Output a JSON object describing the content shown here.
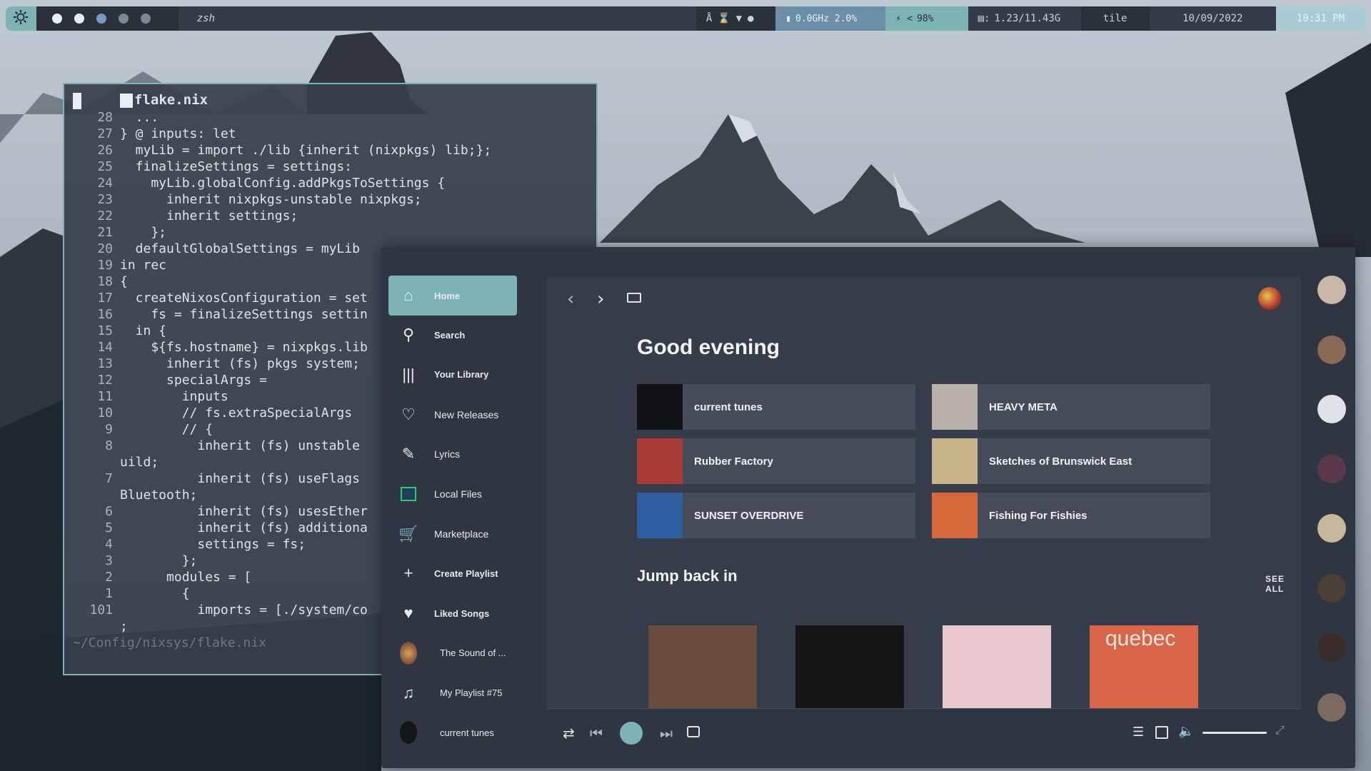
{
  "topbar": {
    "app": "zsh",
    "cpu": "0.0GHz 2.0%",
    "battery": "98%",
    "battery_prefix": "<",
    "memory": "1.23/11.43G",
    "layout": "tile",
    "date": "10/09/2022",
    "time": "10:31 PM",
    "workspace_dots": [
      "#e9eef2",
      "#e9eef2",
      "#7a98c4",
      "#7d8793",
      "#7d8793"
    ]
  },
  "terminal": {
    "title": "flake.nix",
    "path": "~/Config/nixsys/flake.nix",
    "lines": [
      {
        "n": "28",
        "t": "  ..."
      },
      {
        "n": "27",
        "t": "} @ inputs: let"
      },
      {
        "n": "26",
        "t": "  myLib = import ./lib {inherit (nixpkgs) lib;};"
      },
      {
        "n": "25",
        "t": "  finalizeSettings = settings:"
      },
      {
        "n": "24",
        "t": "    myLib.globalConfig.addPkgsToSettings {"
      },
      {
        "n": "23",
        "t": "      inherit nixpkgs-unstable nixpkgs;"
      },
      {
        "n": "22",
        "t": "      inherit settings;"
      },
      {
        "n": "21",
        "t": "    };"
      },
      {
        "n": "20",
        "t": "  defaultGlobalSettings = myLib"
      },
      {
        "n": "19",
        "t": "in rec"
      },
      {
        "n": "18",
        "t": "{"
      },
      {
        "n": "17",
        "t": "  createNixosConfiguration = set"
      },
      {
        "n": "16",
        "t": "    fs = finalizeSettings settin"
      },
      {
        "n": "15",
        "t": "  in {"
      },
      {
        "n": "14",
        "t": "    ${fs.hostname} = nixpkgs.lib"
      },
      {
        "n": "13",
        "t": "      inherit (fs) pkgs system;"
      },
      {
        "n": "12",
        "t": "      specialArgs ="
      },
      {
        "n": "11",
        "t": "        inputs"
      },
      {
        "n": "10",
        "t": "        // fs.extraSpecialArgs"
      },
      {
        "n": "9",
        "t": "        // {"
      },
      {
        "n": "8",
        "t": "          inherit (fs) unstable"
      },
      {
        "n": "",
        "t": "uild;"
      },
      {
        "n": "7",
        "t": "          inherit (fs) useFlags"
      },
      {
        "n": "",
        "t": "Bluetooth;"
      },
      {
        "n": "6",
        "t": "          inherit (fs) usesEther"
      },
      {
        "n": "5",
        "t": "          inherit (fs) additiona"
      },
      {
        "n": "4",
        "t": "          settings = fs;"
      },
      {
        "n": "3",
        "t": "        };"
      },
      {
        "n": "2",
        "t": "      modules = ["
      },
      {
        "n": "1",
        "t": "        {"
      },
      {
        "n": "101",
        "t": "          imports = [./system/co"
      },
      {
        "n": "",
        "t": ";"
      }
    ]
  },
  "sidebar": {
    "items": [
      {
        "label": "Home",
        "icon": "home-icon",
        "bold": true
      },
      {
        "label": "Search",
        "icon": "search-icon",
        "bold": true
      },
      {
        "label": "Your Library",
        "icon": "library-icon",
        "bold": true
      },
      {
        "label": "New Releases",
        "icon": "bell-icon",
        "bold": false
      },
      {
        "label": "Lyrics",
        "icon": "microphone-icon",
        "bold": false
      },
      {
        "label": "Local Files",
        "icon": "folder-icon",
        "bold": false
      },
      {
        "label": "Marketplace",
        "icon": "cart-icon",
        "bold": false
      },
      {
        "label": "Create Playlist",
        "icon": "plus-icon",
        "bold": true
      },
      {
        "label": "Liked Songs",
        "icon": "heart-icon",
        "bold": true
      },
      {
        "label": "The Sound of ...",
        "icon": "playlist-avatar-icon",
        "bold": false
      },
      {
        "label": "My Playlist #75",
        "icon": "music-note-icon",
        "bold": false
      },
      {
        "label": "current tunes",
        "icon": "playlist-avatar-icon",
        "bold": false
      }
    ]
  },
  "main": {
    "greeting": "Good evening",
    "shortcuts": [
      {
        "title": "current tunes",
        "color": "#111318"
      },
      {
        "title": "HEAVY META",
        "color": "#b8b2aa"
      },
      {
        "title": "Rubber Factory",
        "color": "#a83a35"
      },
      {
        "title": "Sketches of Brunswick East",
        "color": "#c9b489"
      },
      {
        "title": "SUNSET OVERDRIVE",
        "color": "#2f5fa0"
      },
      {
        "title": "Fishing For Fishies",
        "color": "#d6683a"
      }
    ],
    "jump_back": "Jump back in",
    "see_all": "SEE ALL",
    "albums": [
      {
        "color": "#6a4c3a"
      },
      {
        "color": "#151515"
      },
      {
        "color": "#e8c8cf"
      },
      {
        "color": "#d9654a",
        "text": "quebec"
      }
    ]
  },
  "colors": {
    "accent": "#7eb3b5",
    "panel": "#363c49",
    "card": "#454b58"
  }
}
